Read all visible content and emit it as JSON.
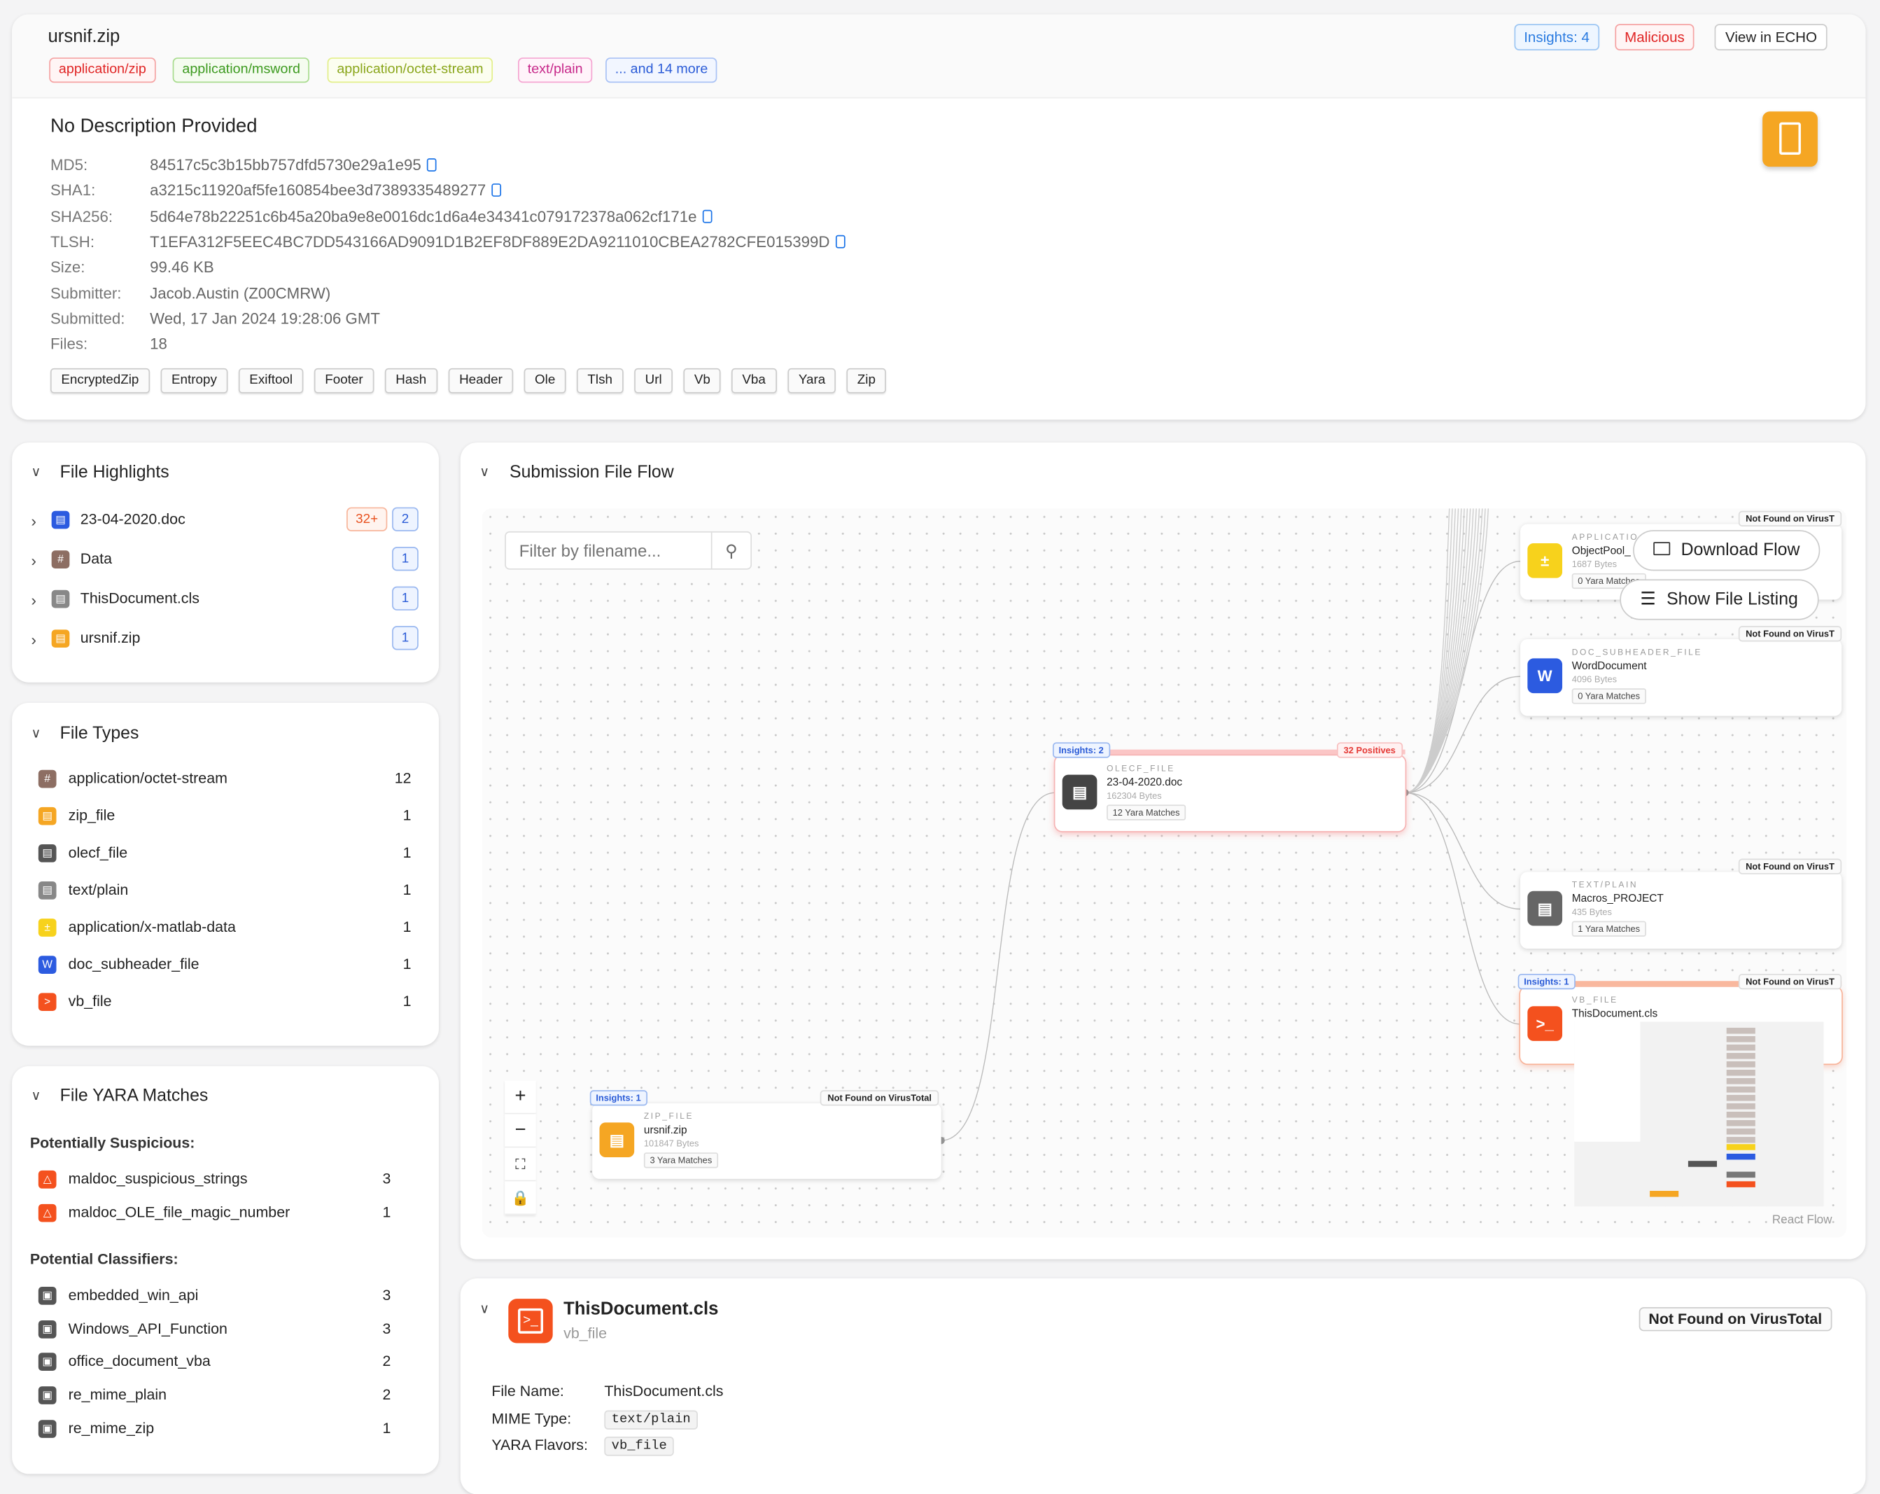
{
  "header": {
    "title": "ursnif.zip",
    "mime_tags": [
      "application/zip",
      "application/msword",
      "application/octet-stream",
      "text/plain",
      "... and 14 more"
    ],
    "insights_badge": "Insights: 4",
    "verdict_badge": "Malicious",
    "view_button": "View in ECHO"
  },
  "summary": {
    "description": "No Description Provided",
    "rows": [
      {
        "label": "MD5:",
        "value": "84517c5c3b15bb757dfd5730e29a1e95",
        "copy": true
      },
      {
        "label": "SHA1:",
        "value": "a3215c11920af5fe160854bee3d7389335489277",
        "copy": true
      },
      {
        "label": "SHA256:",
        "value": "5d64e78b22251c6b45a20ba9e8e0016dc1d6a4e34341c079172378a062cf171e",
        "copy": true
      },
      {
        "label": "TLSH:",
        "value": "T1EFA312F5EEC4BC7DD543166AD9091D1B2EF8DF889E2DA9211010CBEA2782CFE015399D",
        "copy": true
      },
      {
        "label": "Size:",
        "value": "99.46 KB"
      },
      {
        "label": "Submitter:",
        "value": "Jacob.Austin (Z00CMRW)"
      },
      {
        "label": "Submitted:",
        "value": "Wed, 17 Jan 2024 19:28:06 GMT"
      },
      {
        "label": "Files:",
        "value": "18"
      }
    ],
    "plugins": [
      "EncryptedZip",
      "Entropy",
      "Exiftool",
      "Footer",
      "Hash",
      "Header",
      "Ole",
      "Tlsh",
      "Url",
      "Vb",
      "Vba",
      "Yara",
      "Zip"
    ]
  },
  "highlights": {
    "title": "File Highlights",
    "items": [
      {
        "name": "23-04-2020.doc",
        "icon": "word-doc-icon",
        "badges": [
          "32+",
          "2"
        ]
      },
      {
        "name": "Data",
        "icon": "hash-icon",
        "badges": [
          "1"
        ]
      },
      {
        "name": "ThisDocument.cls",
        "icon": "text-file-icon",
        "badges": [
          "1"
        ]
      },
      {
        "name": "ursnif.zip",
        "icon": "zip-icon",
        "badges": [
          "1"
        ]
      }
    ]
  },
  "file_types": {
    "title": "File Types",
    "items": [
      {
        "name": "application/octet-stream",
        "count": "12",
        "icon": "hash-icon",
        "color": "#8d6e63"
      },
      {
        "name": "zip_file",
        "count": "1",
        "icon": "zip-icon",
        "color": "#f5a623"
      },
      {
        "name": "olecf_file",
        "count": "1",
        "icon": "document-icon",
        "color": "#555555"
      },
      {
        "name": "text/plain",
        "count": "1",
        "icon": "text-file-icon",
        "color": "#888888"
      },
      {
        "name": "application/x-matlab-data",
        "count": "1",
        "icon": "calculator-icon",
        "color": "#f7d21c"
      },
      {
        "name": "doc_subheader_file",
        "count": "1",
        "icon": "word-doc-icon",
        "color": "#2c5be0"
      },
      {
        "name": "vb_file",
        "count": "1",
        "icon": "terminal-icon",
        "color": "#f4511e"
      }
    ]
  },
  "yara": {
    "title": "File YARA Matches",
    "suspicious_label": "Potentially Suspicious:",
    "suspicious": [
      {
        "name": "maldoc_suspicious_strings",
        "count": "3"
      },
      {
        "name": "maldoc_OLE_file_magic_number",
        "count": "1"
      }
    ],
    "classifiers_label": "Potential Classifiers:",
    "classifiers": [
      {
        "name": "embedded_win_api",
        "count": "3"
      },
      {
        "name": "Windows_API_Function",
        "count": "3"
      },
      {
        "name": "office_document_vba",
        "count": "2"
      },
      {
        "name": "re_mime_plain",
        "count": "2"
      },
      {
        "name": "re_mime_zip",
        "count": "1"
      }
    ]
  },
  "flow": {
    "title": "Submission File Flow",
    "filter_placeholder": "Filter by filename...",
    "download_button": "Download Flow",
    "listing_button": "Show File Listing",
    "attribution": "React Flow",
    "nodes": [
      {
        "type": "ZIP_FILE",
        "name": "ursnif.zip",
        "size": "101847 Bytes",
        "yara": "3 Yara Matches",
        "insights": "Insights: 1",
        "vt": "Not Found on VirusTotal"
      },
      {
        "type": "OLECF_FILE",
        "name": "23-04-2020.doc",
        "size": "162304 Bytes",
        "yara": "12 Yara Matches",
        "insights": "Insights: 2",
        "vt": "32 Positives"
      },
      {
        "type": "APPLICATIO",
        "name": "ObjectPool_",
        "size": "1687 Bytes",
        "yara": "0 Yara Matches",
        "vt": "Not Found on VirusT"
      },
      {
        "type": "DOC_SUBHEADER_FILE",
        "name": "WordDocument",
        "size": "4096 Bytes",
        "yara": "0 Yara Matches",
        "vt": "Not Found on VirusT"
      },
      {
        "type": "TEXT/PLAIN",
        "name": "Macros_PROJECT",
        "size": "435 Bytes",
        "yara": "1 Yara Matches",
        "vt": "Not Found on VirusT"
      },
      {
        "type": "VB_FILE",
        "name": "ThisDocument.cls",
        "insights": "Insights: 1",
        "vt": "Not Found on VirusT"
      }
    ]
  },
  "detail": {
    "name": "ThisDocument.cls",
    "type": "vb_file",
    "vt": "Not Found on VirusTotal",
    "rows": [
      {
        "label": "File Name:",
        "value": "ThisDocument.cls"
      },
      {
        "label": "MIME Type:",
        "value": "text/plain"
      },
      {
        "label": "YARA Flavors:",
        "value": "vb_file"
      }
    ]
  },
  "colors": {
    "accent": "#2a5bd7",
    "malicious": "#e53935",
    "zip": "#f5a623",
    "vb": "#f4511e"
  }
}
